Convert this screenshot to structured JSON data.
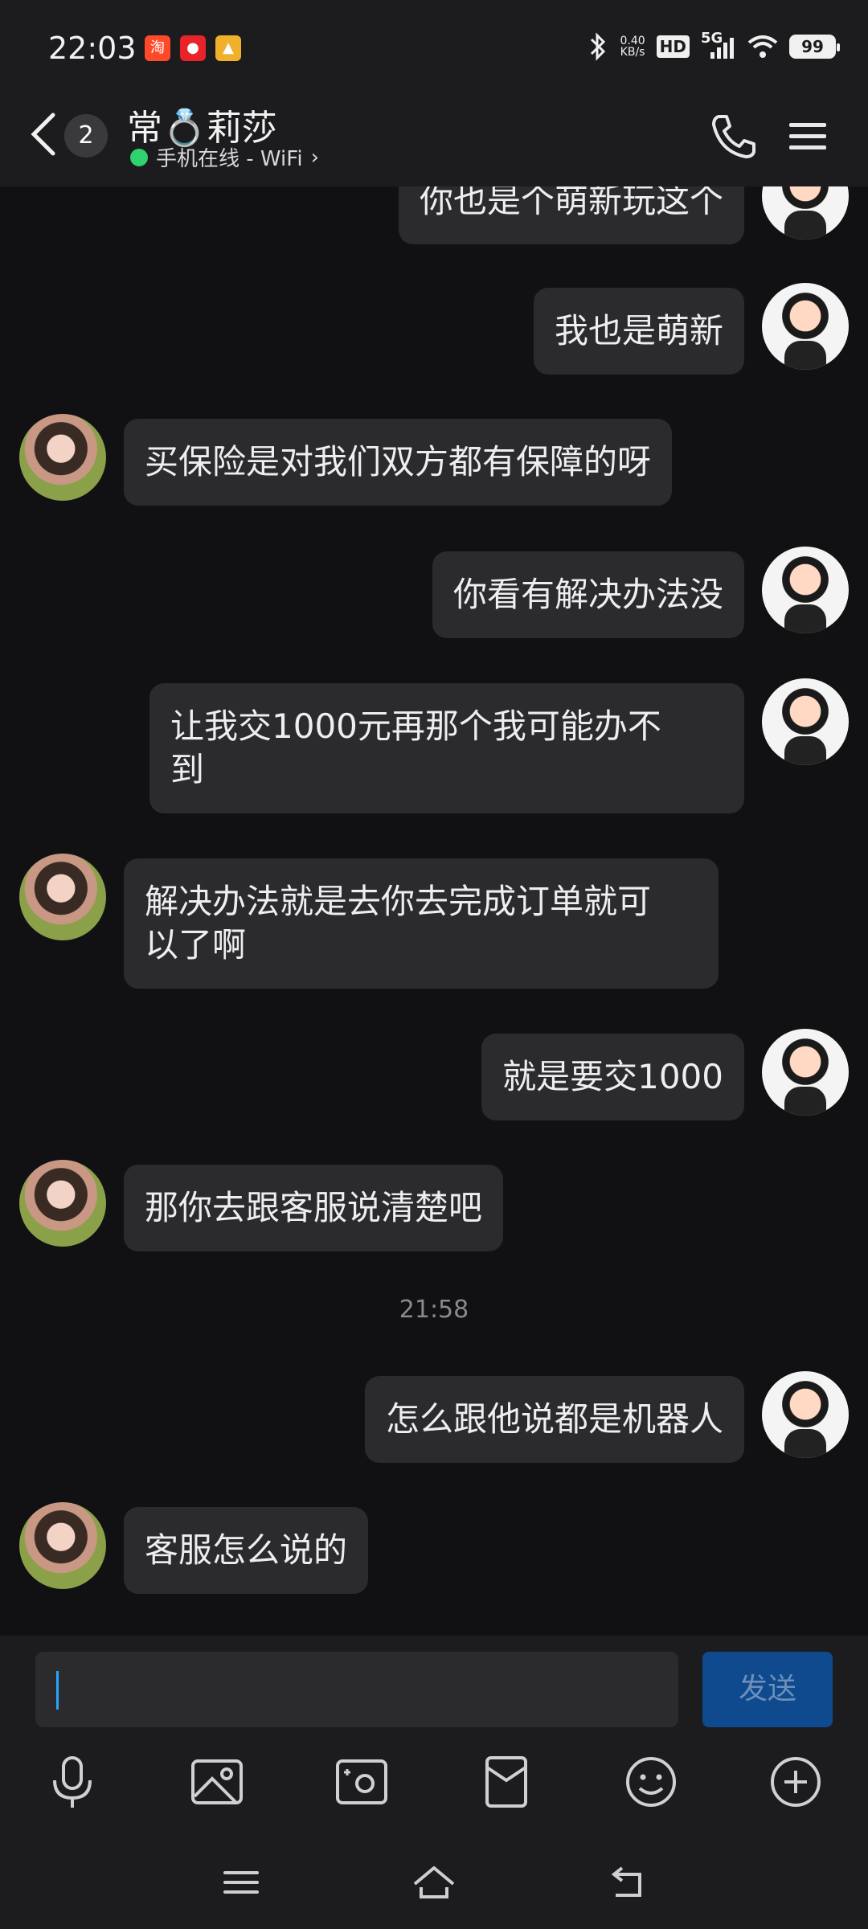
{
  "status_bar": {
    "time": "22:03",
    "speed_value": "0.40",
    "speed_unit": "KB/s",
    "hd": "HD",
    "network": "5G",
    "battery": "99"
  },
  "header": {
    "unread_count": "2",
    "contact_name": "常💍莉莎",
    "status_text": "手机在线 - WiFi",
    "status_chevron": "›"
  },
  "messages": [
    {
      "side": "me",
      "text": "你也是个萌新玩这个"
    },
    {
      "side": "me",
      "text": "我也是萌新"
    },
    {
      "side": "her",
      "text": "买保险是对我们双方都有保障的呀"
    },
    {
      "side": "me",
      "text": "你看有解决办法没"
    },
    {
      "side": "me",
      "text": "让我交1000元再那个我可能办不\n到"
    },
    {
      "side": "her",
      "text": "解决办法就是去你去完成订单就可\n以了啊"
    },
    {
      "side": "me",
      "text": "就是要交1000"
    },
    {
      "side": "her",
      "text": "那你去跟客服说清楚吧"
    },
    {
      "side": "me",
      "text": "怎么跟他说都是机器人"
    },
    {
      "side": "her",
      "text": "客服怎么说的"
    }
  ],
  "timestamp": "21:58",
  "composer": {
    "input_value": "",
    "send_label": "发送"
  },
  "icons": {
    "accent": "#2aa3ff",
    "online": "#2fd26c",
    "send_bg": "#0f4a8f"
  }
}
